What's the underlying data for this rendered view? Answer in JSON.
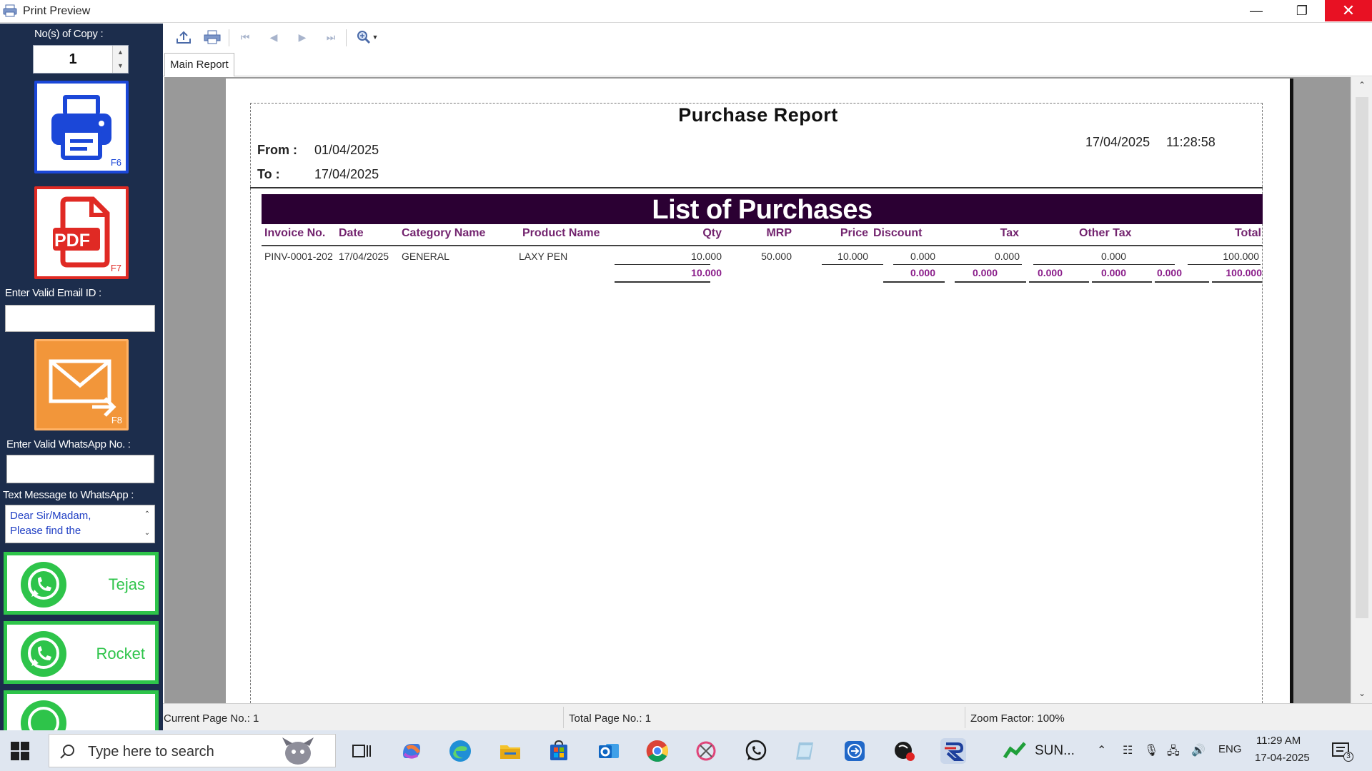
{
  "window": {
    "title": "Print Preview"
  },
  "left_panel": {
    "copies_label": "No(s) of Copy :",
    "copies_value": "1",
    "print_key": "F6",
    "pdf_label": "PDF",
    "pdf_key": "F7",
    "email_label": "Enter Valid Email ID :",
    "email_value": "",
    "email_key": "F8",
    "whatsapp_label": "Enter Valid WhatsApp No. :",
    "whatsapp_value": "",
    "message_label": "Text Message to WhatsApp :",
    "message_text": "Dear Sir/Madam,\nPlease find the",
    "whatsapp_contacts": [
      "Tejas",
      "Rocket"
    ]
  },
  "tabs": [
    "Main Report"
  ],
  "report": {
    "title": "Purchase Report",
    "from_label": "From :",
    "from_date": "01/04/2025",
    "to_label": "To :",
    "to_date": "17/04/2025",
    "print_date": "17/04/2025",
    "print_time": "11:28:58",
    "band_title": "List of Purchases",
    "columns": [
      "Invoice No.",
      "Date",
      "Category Name",
      "Product Name",
      "Qty",
      "MRP",
      "Price",
      "Discount",
      "Tax",
      "Other Tax",
      "Total"
    ],
    "rows": [
      {
        "invoice": "PINV-0001-202",
        "date": "17/04/2025",
        "category": "GENERAL",
        "product": "LAXY PEN",
        "qty": "10.000",
        "mrp": "50.000",
        "price": "10.000",
        "discount": "0.000",
        "tax": "0.000",
        "other_tax": "0.000",
        "total": "100.000"
      }
    ],
    "totals": {
      "qty": "10.000",
      "discount": "0.000",
      "tax_a": "0.000",
      "tax_b": "0.000",
      "other_tax_a": "0.000",
      "other_tax_b": "0.000",
      "total": "100.000"
    }
  },
  "status_bar": {
    "current_page": "Current Page No.: 1",
    "total_pages": "Total Page No.: 1",
    "zoom": "Zoom Factor: 100%"
  },
  "taskbar": {
    "search_placeholder": "Type here to search",
    "tray_app_label": "SUN...",
    "language": "ENG",
    "time": "11:29 AM",
    "date": "17-04-2025",
    "notification_count": "3"
  },
  "colors": {
    "left_panel_bg": "#1c2d4c",
    "band_bg": "#2b0033",
    "column_header": "#73246f",
    "whatsapp_green": "#2ec44a",
    "print_blue": "#1b47d8",
    "pdf_red": "#e02a24",
    "email_orange": "#f2963a",
    "close_red": "#e81123"
  }
}
